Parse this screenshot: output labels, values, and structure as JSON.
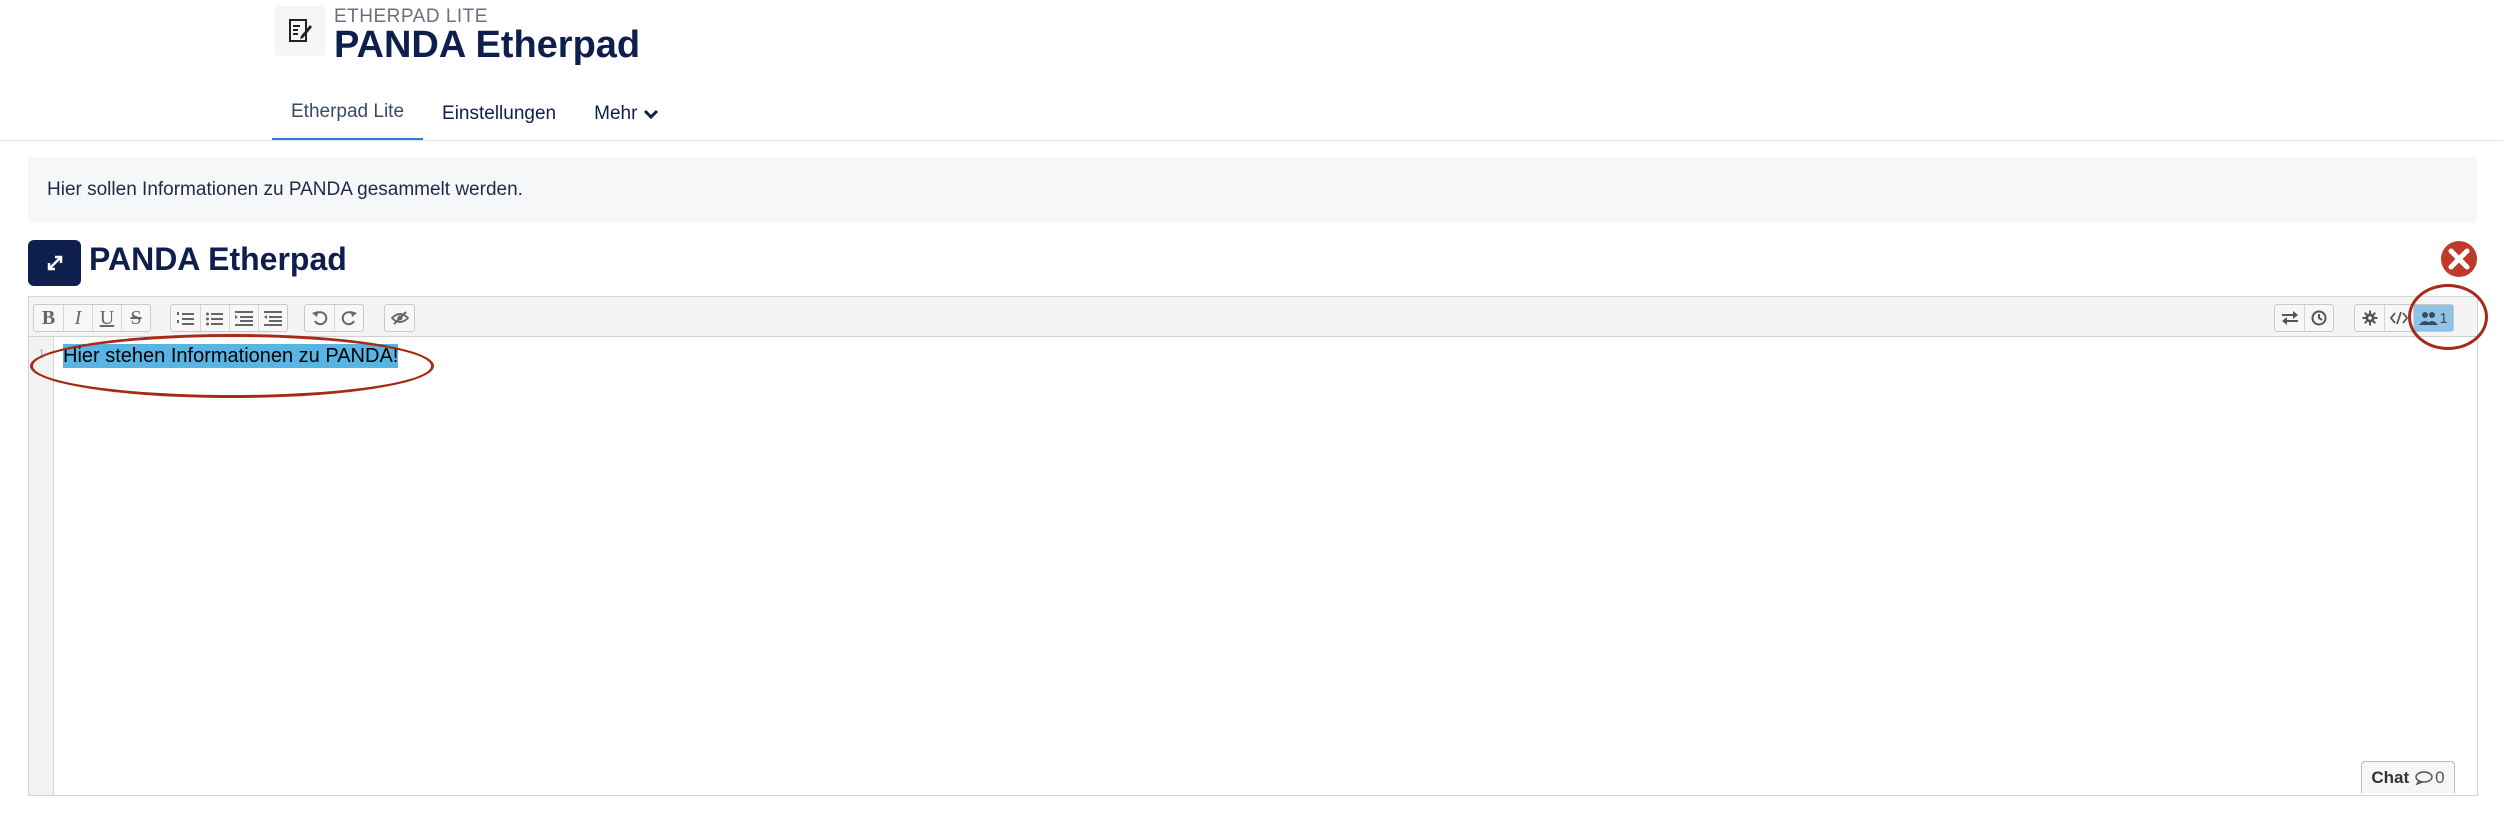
{
  "header": {
    "module_type": "ETHERPAD LITE",
    "title": "PANDA Etherpad",
    "module_icon": "etherpad-icon"
  },
  "nav": {
    "tabs": [
      {
        "label": "Etherpad Lite",
        "active": true
      },
      {
        "label": "Einstellungen",
        "active": false
      },
      {
        "label": "Mehr",
        "active": false,
        "icon": "chevron-down-icon"
      }
    ]
  },
  "intro": {
    "text": "Hier sollen Informationen zu PANDA gesammelt werden."
  },
  "activity": {
    "title": "PANDA Etherpad",
    "expand_icon": "expand-icon",
    "close_icon": "close-icon"
  },
  "toolbar": {
    "format_buttons": [
      "B",
      "I",
      "U",
      "S"
    ],
    "list_icons": [
      "ordered-list-icon",
      "unordered-list-icon",
      "indent-icon",
      "outdent-icon"
    ],
    "history_icons": [
      "undo-icon",
      "redo-icon"
    ],
    "clear_authorship_icon": "eye-slash-icon",
    "right_icons": [
      "import-export-icon",
      "timeslider-icon",
      "settings-icon",
      "embed-icon"
    ],
    "user_count": "1"
  },
  "editor": {
    "line_number": "1",
    "text": "Hier stehen Informationen zu PANDA!"
  },
  "chat": {
    "label": "Chat",
    "count": "0"
  },
  "colors": {
    "brand_navy": "#0f1f4d",
    "tab_active_underline": "#2f7ed8",
    "selection": "#58b5e3",
    "annotation": "#a62a18",
    "close_red": "#c0392b"
  }
}
